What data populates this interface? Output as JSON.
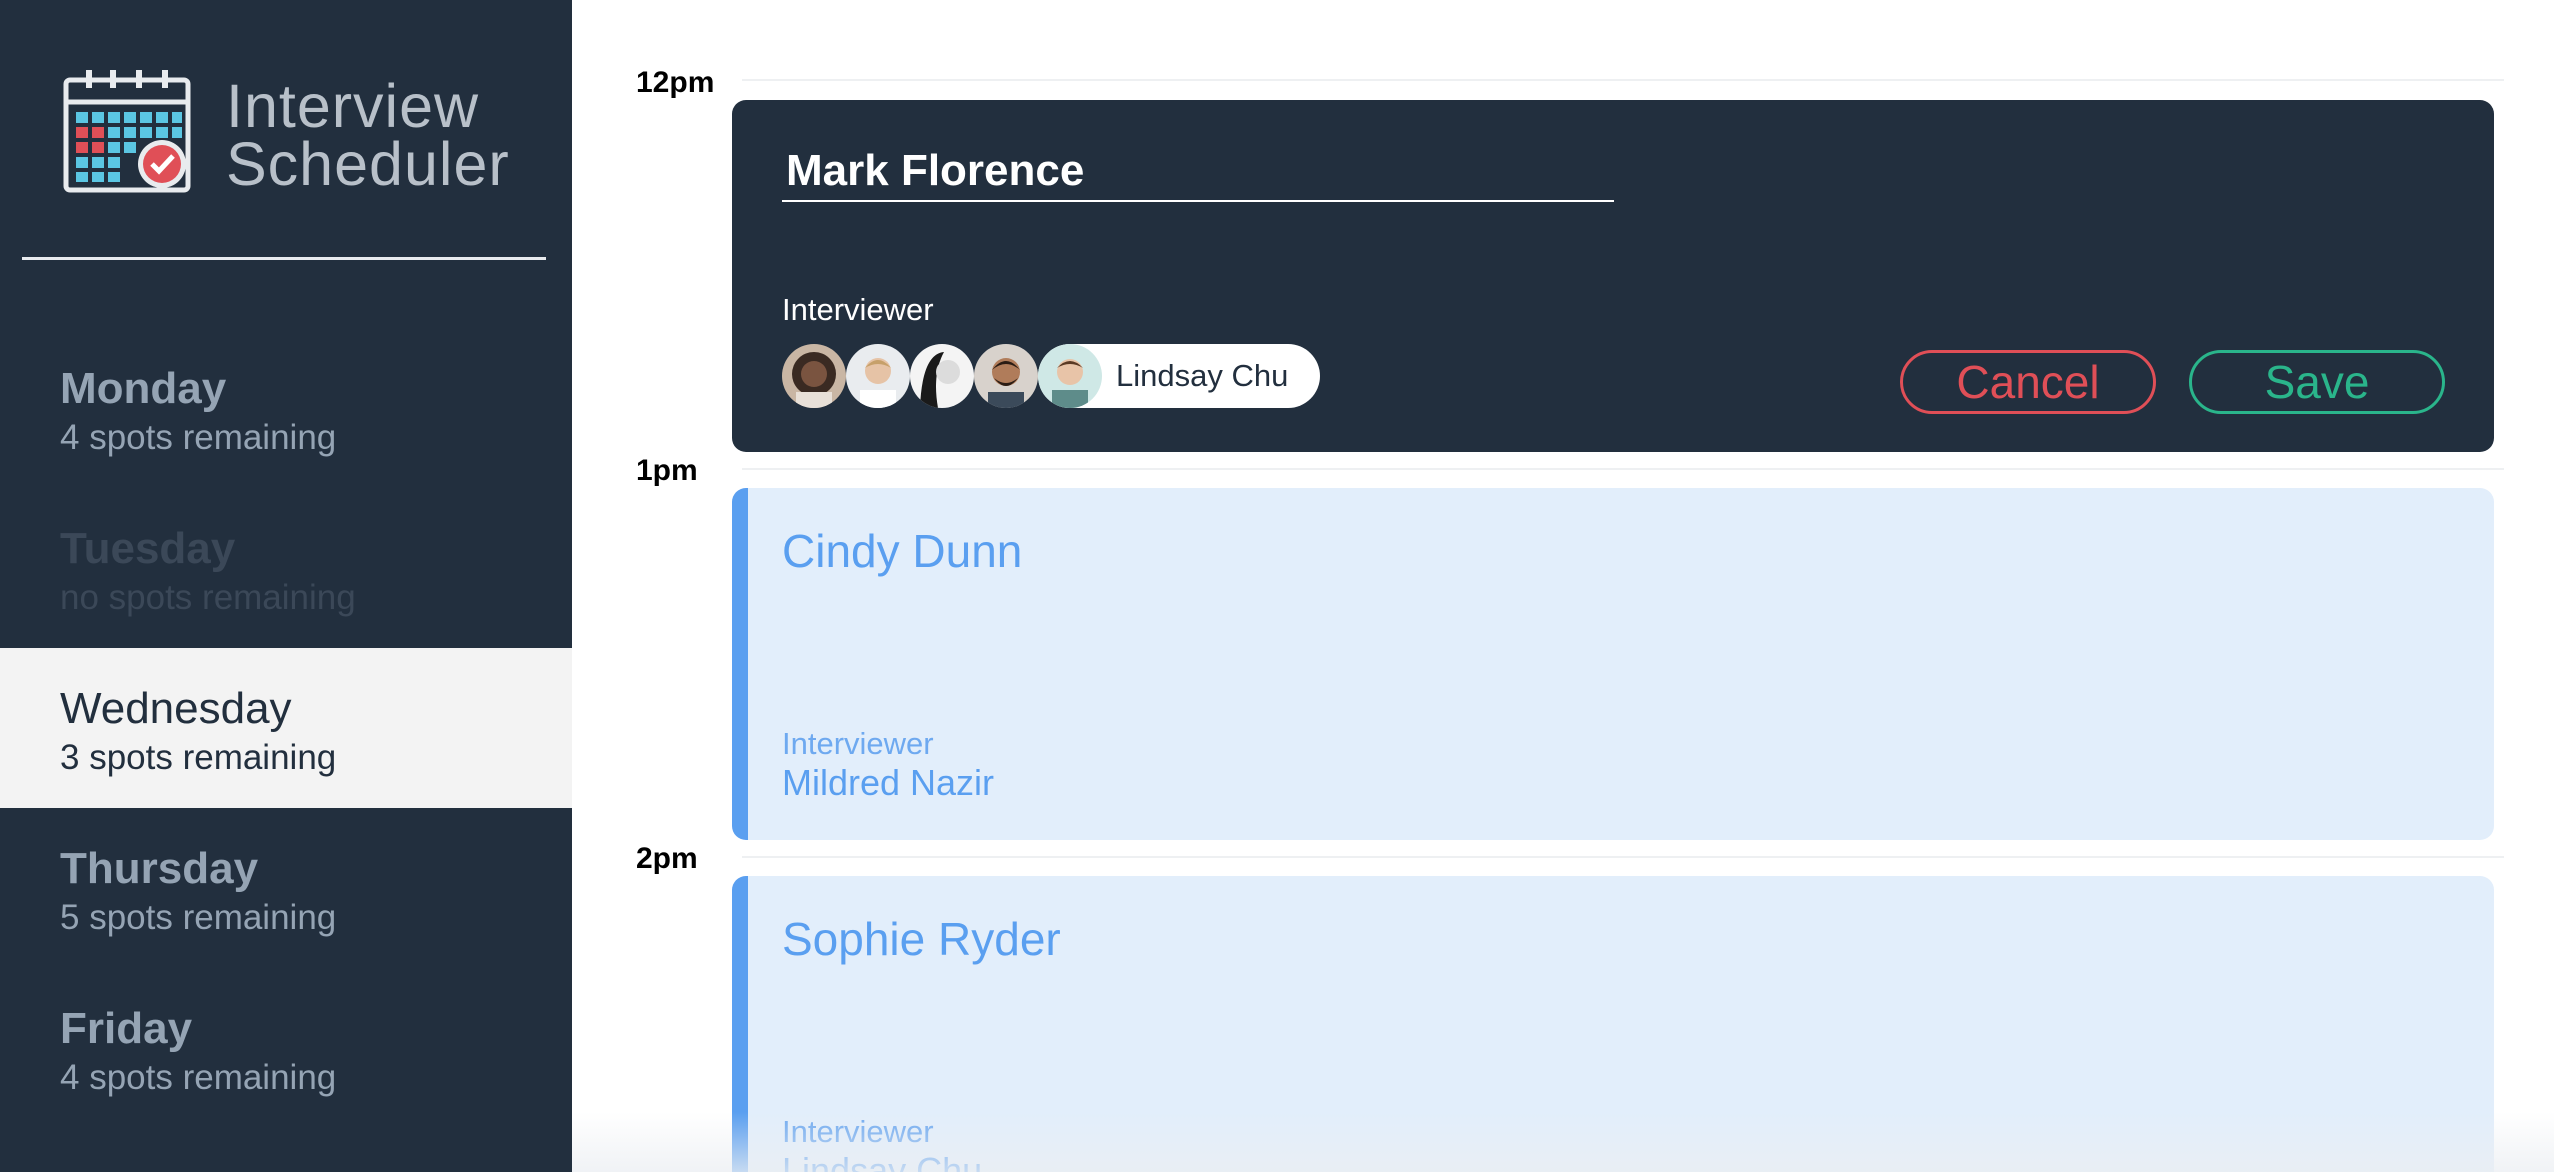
{
  "app": {
    "title_line1": "Interview",
    "title_line2": "Scheduler",
    "logo_icon": "calendar-check-icon"
  },
  "sidebar": {
    "days": [
      {
        "name": "Monday",
        "spots": "4 spots remaining",
        "state": "normal"
      },
      {
        "name": "Tuesday",
        "spots": "no spots remaining",
        "state": "full"
      },
      {
        "name": "Wednesday",
        "spots": "3 spots remaining",
        "state": "selected"
      },
      {
        "name": "Thursday",
        "spots": "5 spots remaining",
        "state": "normal"
      },
      {
        "name": "Friday",
        "spots": "4 spots remaining",
        "state": "normal"
      }
    ]
  },
  "schedule": {
    "times": [
      "12pm",
      "1pm",
      "2pm"
    ],
    "editor": {
      "student_value": "Mark Florence",
      "interviewer_label": "Interviewer",
      "selected_interviewer": "Lindsay Chu",
      "cancel_label": "Cancel",
      "save_label": "Save"
    },
    "appointments": [
      {
        "student": "Cindy Dunn",
        "interviewer_label": "Interviewer",
        "interviewer": "Mildred Nazir"
      },
      {
        "student": "Sophie Ryder",
        "interviewer_label": "Interviewer",
        "interviewer": "Lindsay Chu"
      }
    ]
  },
  "colors": {
    "sidebar_bg": "#222f3e",
    "appointment_bg": "#e2eefb",
    "accent_blue": "#5a9ff0",
    "cancel_red": "#e04f57",
    "save_green": "#2ab58b"
  }
}
